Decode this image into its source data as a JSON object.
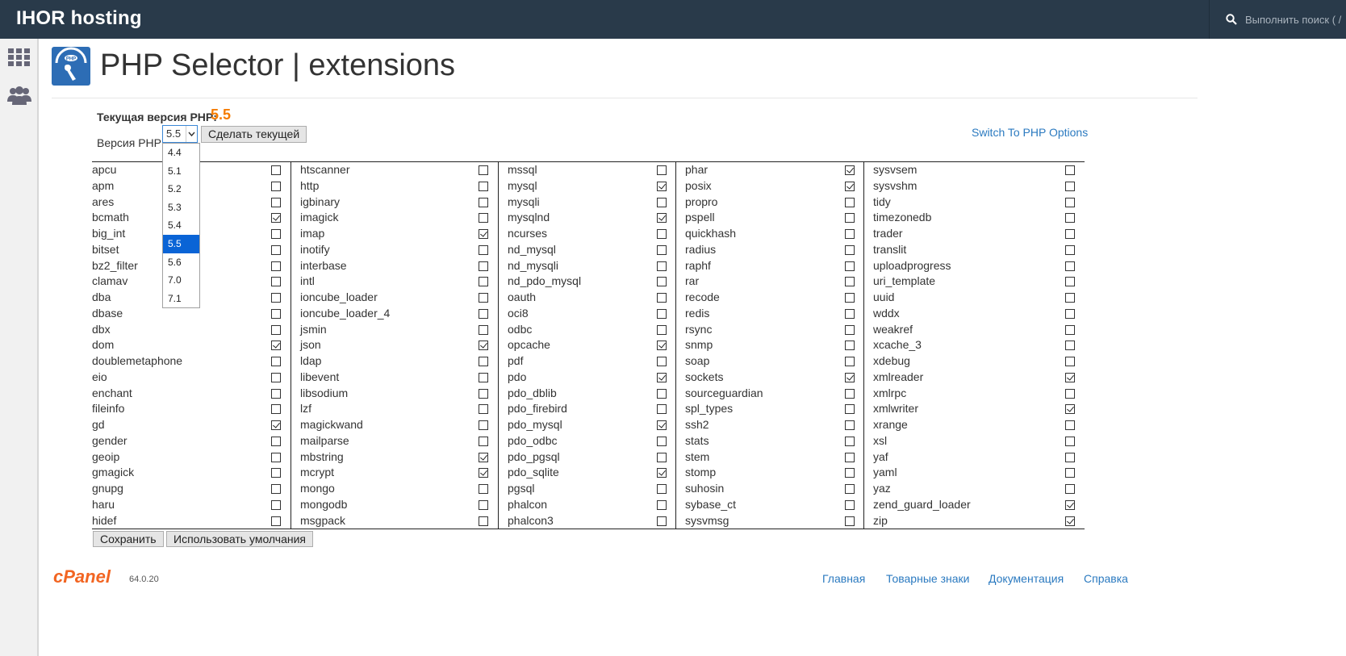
{
  "header": {
    "brand": "IHOR hosting",
    "search_placeholder": "Выполнить поиск ( /"
  },
  "page": {
    "title": "PHP Selector | extensions"
  },
  "current_version": {
    "label": "Текущая версия PHP:",
    "value": "5.5"
  },
  "version_select": {
    "label": "Версия PHP",
    "selected": "5.5",
    "options": [
      "4.4",
      "5.1",
      "5.2",
      "5.3",
      "5.4",
      "5.5",
      "5.6",
      "7.0",
      "7.1"
    ],
    "make_current_label": "Сделать текущей"
  },
  "switch_link": "Switch To PHP Options",
  "extensions": [
    [
      {
        "name": "apcu",
        "checked": false
      },
      {
        "name": "apm",
        "checked": false
      },
      {
        "name": "ares",
        "checked": false
      },
      {
        "name": "bcmath",
        "checked": true
      },
      {
        "name": "big_int",
        "checked": false
      },
      {
        "name": "bitset",
        "checked": false
      },
      {
        "name": "bz2_filter",
        "checked": false
      },
      {
        "name": "clamav",
        "checked": false
      },
      {
        "name": "dba",
        "checked": false
      },
      {
        "name": "dbase",
        "checked": false
      },
      {
        "name": "dbx",
        "checked": false
      },
      {
        "name": "dom",
        "checked": true
      },
      {
        "name": "doublemetaphone",
        "checked": false
      },
      {
        "name": "eio",
        "checked": false
      },
      {
        "name": "enchant",
        "checked": false
      },
      {
        "name": "fileinfo",
        "checked": false
      },
      {
        "name": "gd",
        "checked": true
      },
      {
        "name": "gender",
        "checked": false
      },
      {
        "name": "geoip",
        "checked": false
      },
      {
        "name": "gmagick",
        "checked": false
      },
      {
        "name": "gnupg",
        "checked": false
      },
      {
        "name": "haru",
        "checked": false
      },
      {
        "name": "hidef",
        "checked": false
      }
    ],
    [
      {
        "name": "htscanner",
        "checked": false
      },
      {
        "name": "http",
        "checked": false
      },
      {
        "name": "igbinary",
        "checked": false
      },
      {
        "name": "imagick",
        "checked": false
      },
      {
        "name": "imap",
        "checked": true
      },
      {
        "name": "inotify",
        "checked": false
      },
      {
        "name": "interbase",
        "checked": false
      },
      {
        "name": "intl",
        "checked": false
      },
      {
        "name": "ioncube_loader",
        "checked": false
      },
      {
        "name": "ioncube_loader_4",
        "checked": false
      },
      {
        "name": "jsmin",
        "checked": false
      },
      {
        "name": "json",
        "checked": true
      },
      {
        "name": "ldap",
        "checked": false
      },
      {
        "name": "libevent",
        "checked": false
      },
      {
        "name": "libsodium",
        "checked": false
      },
      {
        "name": "lzf",
        "checked": false
      },
      {
        "name": "magickwand",
        "checked": false
      },
      {
        "name": "mailparse",
        "checked": false
      },
      {
        "name": "mbstring",
        "checked": true
      },
      {
        "name": "mcrypt",
        "checked": true
      },
      {
        "name": "mongo",
        "checked": false
      },
      {
        "name": "mongodb",
        "checked": false
      },
      {
        "name": "msgpack",
        "checked": false
      }
    ],
    [
      {
        "name": "mssql",
        "checked": false
      },
      {
        "name": "mysql",
        "checked": true
      },
      {
        "name": "mysqli",
        "checked": false
      },
      {
        "name": "mysqlnd",
        "checked": true
      },
      {
        "name": "ncurses",
        "checked": false
      },
      {
        "name": "nd_mysql",
        "checked": false
      },
      {
        "name": "nd_mysqli",
        "checked": false
      },
      {
        "name": "nd_pdo_mysql",
        "checked": false
      },
      {
        "name": "oauth",
        "checked": false
      },
      {
        "name": "oci8",
        "checked": false
      },
      {
        "name": "odbc",
        "checked": false
      },
      {
        "name": "opcache",
        "checked": true
      },
      {
        "name": "pdf",
        "checked": false
      },
      {
        "name": "pdo",
        "checked": true
      },
      {
        "name": "pdo_dblib",
        "checked": false
      },
      {
        "name": "pdo_firebird",
        "checked": false
      },
      {
        "name": "pdo_mysql",
        "checked": true
      },
      {
        "name": "pdo_odbc",
        "checked": false
      },
      {
        "name": "pdo_pgsql",
        "checked": false
      },
      {
        "name": "pdo_sqlite",
        "checked": true
      },
      {
        "name": "pgsql",
        "checked": false
      },
      {
        "name": "phalcon",
        "checked": false
      },
      {
        "name": "phalcon3",
        "checked": false
      }
    ],
    [
      {
        "name": "phar",
        "checked": true
      },
      {
        "name": "posix",
        "checked": true
      },
      {
        "name": "propro",
        "checked": false
      },
      {
        "name": "pspell",
        "checked": false
      },
      {
        "name": "quickhash",
        "checked": false
      },
      {
        "name": "radius",
        "checked": false
      },
      {
        "name": "raphf",
        "checked": false
      },
      {
        "name": "rar",
        "checked": false
      },
      {
        "name": "recode",
        "checked": false
      },
      {
        "name": "redis",
        "checked": false
      },
      {
        "name": "rsync",
        "checked": false
      },
      {
        "name": "snmp",
        "checked": false
      },
      {
        "name": "soap",
        "checked": false
      },
      {
        "name": "sockets",
        "checked": true
      },
      {
        "name": "sourceguardian",
        "checked": false
      },
      {
        "name": "spl_types",
        "checked": false
      },
      {
        "name": "ssh2",
        "checked": false
      },
      {
        "name": "stats",
        "checked": false
      },
      {
        "name": "stem",
        "checked": false
      },
      {
        "name": "stomp",
        "checked": false
      },
      {
        "name": "suhosin",
        "checked": false
      },
      {
        "name": "sybase_ct",
        "checked": false
      },
      {
        "name": "sysvmsg",
        "checked": false
      }
    ],
    [
      {
        "name": "sysvsem",
        "checked": false
      },
      {
        "name": "sysvshm",
        "checked": false
      },
      {
        "name": "tidy",
        "checked": false
      },
      {
        "name": "timezonedb",
        "checked": false
      },
      {
        "name": "trader",
        "checked": false
      },
      {
        "name": "translit",
        "checked": false
      },
      {
        "name": "uploadprogress",
        "checked": false
      },
      {
        "name": "uri_template",
        "checked": false
      },
      {
        "name": "uuid",
        "checked": false
      },
      {
        "name": "wddx",
        "checked": false
      },
      {
        "name": "weakref",
        "checked": false
      },
      {
        "name": "xcache_3",
        "checked": false
      },
      {
        "name": "xdebug",
        "checked": false
      },
      {
        "name": "xmlreader",
        "checked": true
      },
      {
        "name": "xmlrpc",
        "checked": false
      },
      {
        "name": "xmlwriter",
        "checked": true
      },
      {
        "name": "xrange",
        "checked": false
      },
      {
        "name": "xsl",
        "checked": false
      },
      {
        "name": "yaf",
        "checked": false
      },
      {
        "name": "yaml",
        "checked": false
      },
      {
        "name": "yaz",
        "checked": false
      },
      {
        "name": "zend_guard_loader",
        "checked": true
      },
      {
        "name": "zip",
        "checked": true
      }
    ]
  ],
  "actions": {
    "save_label": "Сохранить",
    "defaults_label": "Использовать умолчания"
  },
  "footer": {
    "logo": "cPanel",
    "version": "64.0.20",
    "links": [
      "Главная",
      "Товарные знаки",
      "Документация",
      "Справка"
    ]
  },
  "colors": {
    "topbar": "#293a4a",
    "accent_orange": "#f57c00",
    "link_blue": "#2b7ac0",
    "selected_option": "#0a64d6"
  }
}
